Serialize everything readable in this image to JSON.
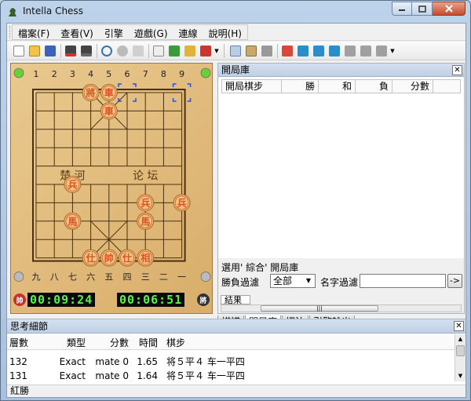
{
  "window": {
    "title": "Intella Chess"
  },
  "menu": [
    {
      "label": "檔案(F)"
    },
    {
      "label": "查看(V)"
    },
    {
      "label": "引擎"
    },
    {
      "label": "遊戲(G)"
    },
    {
      "label": "連線"
    },
    {
      "label": "說明(H)"
    }
  ],
  "board": {
    "top_numbers": [
      "1",
      "2",
      "3",
      "4",
      "5",
      "6",
      "7",
      "8",
      "9"
    ],
    "bottom_numbers": [
      "九",
      "八",
      "七",
      "六",
      "五",
      "四",
      "三",
      "二",
      "一"
    ],
    "river_left": "楚 河",
    "river_right": "论 坛",
    "red_color": "#d8542b",
    "piece_bg": "#f3c27c",
    "pieces": [
      {
        "glyph": "將",
        "col": 3,
        "row": 0
      },
      {
        "glyph": "車",
        "col": 4,
        "row": 0
      },
      {
        "glyph": "車",
        "col": 4,
        "row": 1
      },
      {
        "glyph": "兵",
        "col": 2,
        "row": 5
      },
      {
        "glyph": "兵",
        "col": 6,
        "row": 6
      },
      {
        "glyph": "兵",
        "col": 8,
        "row": 6
      },
      {
        "glyph": "馬",
        "col": 2,
        "row": 7
      },
      {
        "glyph": "馬",
        "col": 6,
        "row": 7
      },
      {
        "glyph": "仕",
        "col": 3,
        "row": 9
      },
      {
        "glyph": "帥",
        "col": 4,
        "row": 9
      },
      {
        "glyph": "仕",
        "col": 5,
        "row": 9
      },
      {
        "glyph": "相",
        "col": 6,
        "row": 9
      }
    ]
  },
  "clocks": {
    "red_time": "00:09:24",
    "black_time": "00:06:51",
    "red_badge": "帥",
    "black_badge": "將"
  },
  "opening_panel": {
    "title": "開局庫",
    "columns": [
      "開局棋步",
      "勝",
      "和",
      "負",
      "分數"
    ],
    "selected_library": "選用' 綜合' 開局庫",
    "win_loss_label": "勝負過濾",
    "win_loss_value": "全部",
    "name_filter_label": "名字過濾",
    "name_filter_value": "",
    "go_button": "->",
    "result_tab": "結果"
  },
  "tabs": [
    {
      "label": "棋譜",
      "active": false
    },
    {
      "label": "開局庫",
      "active": true
    },
    {
      "label": "招法",
      "active": false
    },
    {
      "label": "引擎輸出",
      "active": false
    }
  ],
  "think_panel": {
    "title": "思考細節",
    "columns": [
      "層數",
      "類型",
      "分數",
      "時間",
      "棋步"
    ],
    "rows": [
      {
        "depth": "132",
        "type": "Exact",
        "score": "mate 0",
        "time": "1.65",
        "move": "将５平４ 车一平四"
      },
      {
        "depth": "131",
        "type": "Exact",
        "score": "mate 0",
        "time": "1.64",
        "move": "将５平４ 车一平四"
      }
    ]
  },
  "status": {
    "text": "紅勝"
  }
}
